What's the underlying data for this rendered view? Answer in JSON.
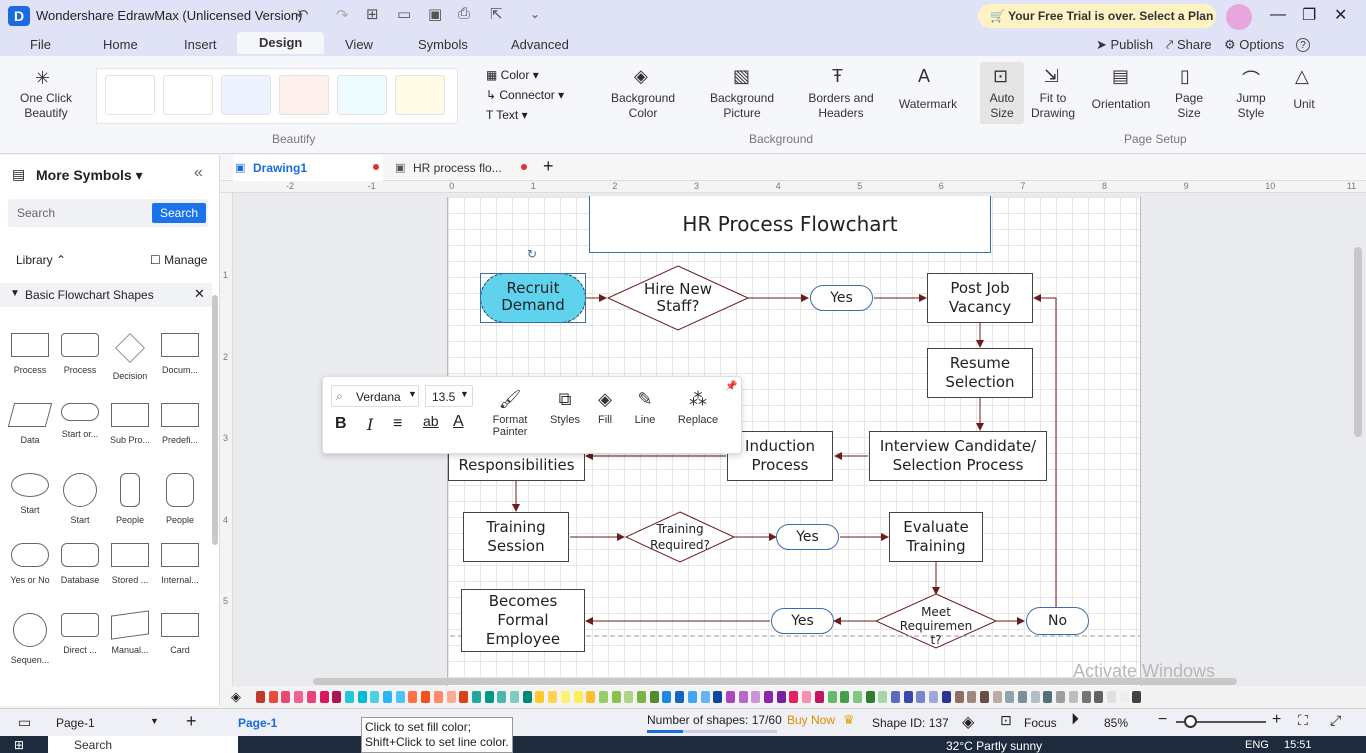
{
  "app": {
    "title": "Wondershare EdrawMax (Unlicensed Version)",
    "trial_banner": "Your Free Trial is over. Select a Plan"
  },
  "menu": {
    "items": [
      "File",
      "Home",
      "Insert",
      "Design",
      "View",
      "Symbols",
      "Advanced"
    ],
    "active": "Design",
    "right": {
      "publish": "Publish",
      "share": "Share",
      "options": "Options",
      "help": "?"
    }
  },
  "ribbon": {
    "one_click_beautify": "One Click Beautify",
    "beautify_group": "Beautify",
    "color": "Color",
    "connector": "Connector",
    "text": "Text",
    "background_color": "Background Color",
    "background_picture": "Background Picture",
    "borders_headers": "Borders and Headers",
    "watermark": "Watermark",
    "background_group": "Background",
    "auto_size": "Auto Size",
    "fit_to_drawing": "Fit to Drawing",
    "orientation": "Orientation",
    "page_size": "Page Size",
    "jump_style": "Jump Style",
    "unit": "Unit",
    "page_setup_group": "Page Setup"
  },
  "left_panel": {
    "title": "More Symbols",
    "search_placeholder": "Search",
    "search_button": "Search",
    "library": "Library",
    "manage": "Manage",
    "category": "Basic Flowchart Shapes",
    "shapes": [
      "Process",
      "Process",
      "Decision",
      "Docum...",
      "Data",
      "Start or...",
      "Sub Pro...",
      "Predefi...",
      "Start",
      "Start",
      "People",
      "People",
      "Yes or No",
      "Database",
      "Stored ...",
      "Internal...",
      "Sequen...",
      "Direct ...",
      "Manual...",
      "Card"
    ]
  },
  "doc_tabs": [
    {
      "label": "Drawing1",
      "active": true
    },
    {
      "label": "HR process flo...",
      "active": false
    }
  ],
  "ruler": {
    "h": [
      "-2",
      "-1",
      "0",
      "1",
      "2",
      "3",
      "4",
      "5",
      "6",
      "7",
      "8",
      "9",
      "10",
      "11"
    ],
    "v": [
      "1",
      "2",
      "3",
      "4",
      "5"
    ]
  },
  "flowchart": {
    "title": "HR Process Flowchart",
    "recruit": "Recruit Demand",
    "hire": "Hire New Staff?",
    "yes1": "Yes",
    "post": "Post Job Vacancy",
    "resume": "Resume Selection",
    "interview": "Interview Candidate/ Selection Process",
    "induction": "Induction Process",
    "responsibilities": "Responsibilities",
    "training_session": "Training Session",
    "training_required": "Training Required?",
    "yes2": "Yes",
    "evaluate": "Evaluate Training",
    "meet": "Meet Requiremen t?",
    "no": "No",
    "yes3": "Yes",
    "formal": "Becomes Formal Employee"
  },
  "format_bar": {
    "font": "Verdana",
    "size": "13.5",
    "bold": "B",
    "italic": "I",
    "format_painter": "Format Painter",
    "styles": "Styles",
    "fill": "Fill",
    "line": "Line",
    "replace": "Replace"
  },
  "watermark": "Activate Windows",
  "colors": [
    "#c0392b",
    "#e74c3c",
    "#e84a6f",
    "#f06292",
    "#ec407a",
    "#d81b60",
    "#ad1457",
    "#26c6da",
    "#00bcd4",
    "#4dd0e1",
    "#29b6f6",
    "#4fc3f7",
    "#ff7043",
    "#f4511e",
    "#ff8a65",
    "#ffab91",
    "#d84315",
    "#26a69a",
    "#009688",
    "#4db6ac",
    "#80cbc4",
    "#00897b",
    "#ffca28",
    "#ffd54f",
    "#fff176",
    "#ffee58",
    "#fbc02d",
    "#9ccc65",
    "#8bc34a",
    "#aed581",
    "#7cb342",
    "#558b2f",
    "#1e88e5",
    "#1565c0",
    "#42a5f5",
    "#64b5f6",
    "#0d47a1",
    "#ab47bc",
    "#ba68c8",
    "#ce93d8",
    "#8e24aa",
    "#7b1fa2",
    "#e91e63",
    "#f48fb1",
    "#c2185b",
    "#66bb6a",
    "#43a047",
    "#81c784",
    "#2e7d32",
    "#a5d6a7",
    "#5c6bc0",
    "#3949ab",
    "#7986cb",
    "#9fa8da",
    "#283593",
    "#8d6e63",
    "#a1887f",
    "#6d4c41",
    "#bcaaa4",
    "#90a4ae",
    "#78909c",
    "#b0bec5",
    "#546e7a",
    "#9e9e9e",
    "#bdbdbd",
    "#757575",
    "#616161",
    "#e0e0e0",
    "#eeeeee",
    "#424242"
  ],
  "status": {
    "page_selector": "Page-1",
    "page_tab": "Page-1",
    "tooltip1": "Click to set fill color;",
    "tooltip2": "Shift+Click to set line color.",
    "shapes": "Number of shapes: 17/60",
    "buy_now": "Buy Now",
    "shape_id": "Shape ID: 137",
    "focus": "Focus",
    "zoom": "85%"
  },
  "taskbar": {
    "search": "Search",
    "weather": "32°C  Partly sunny",
    "lang": "ENG",
    "time": "15:51"
  }
}
